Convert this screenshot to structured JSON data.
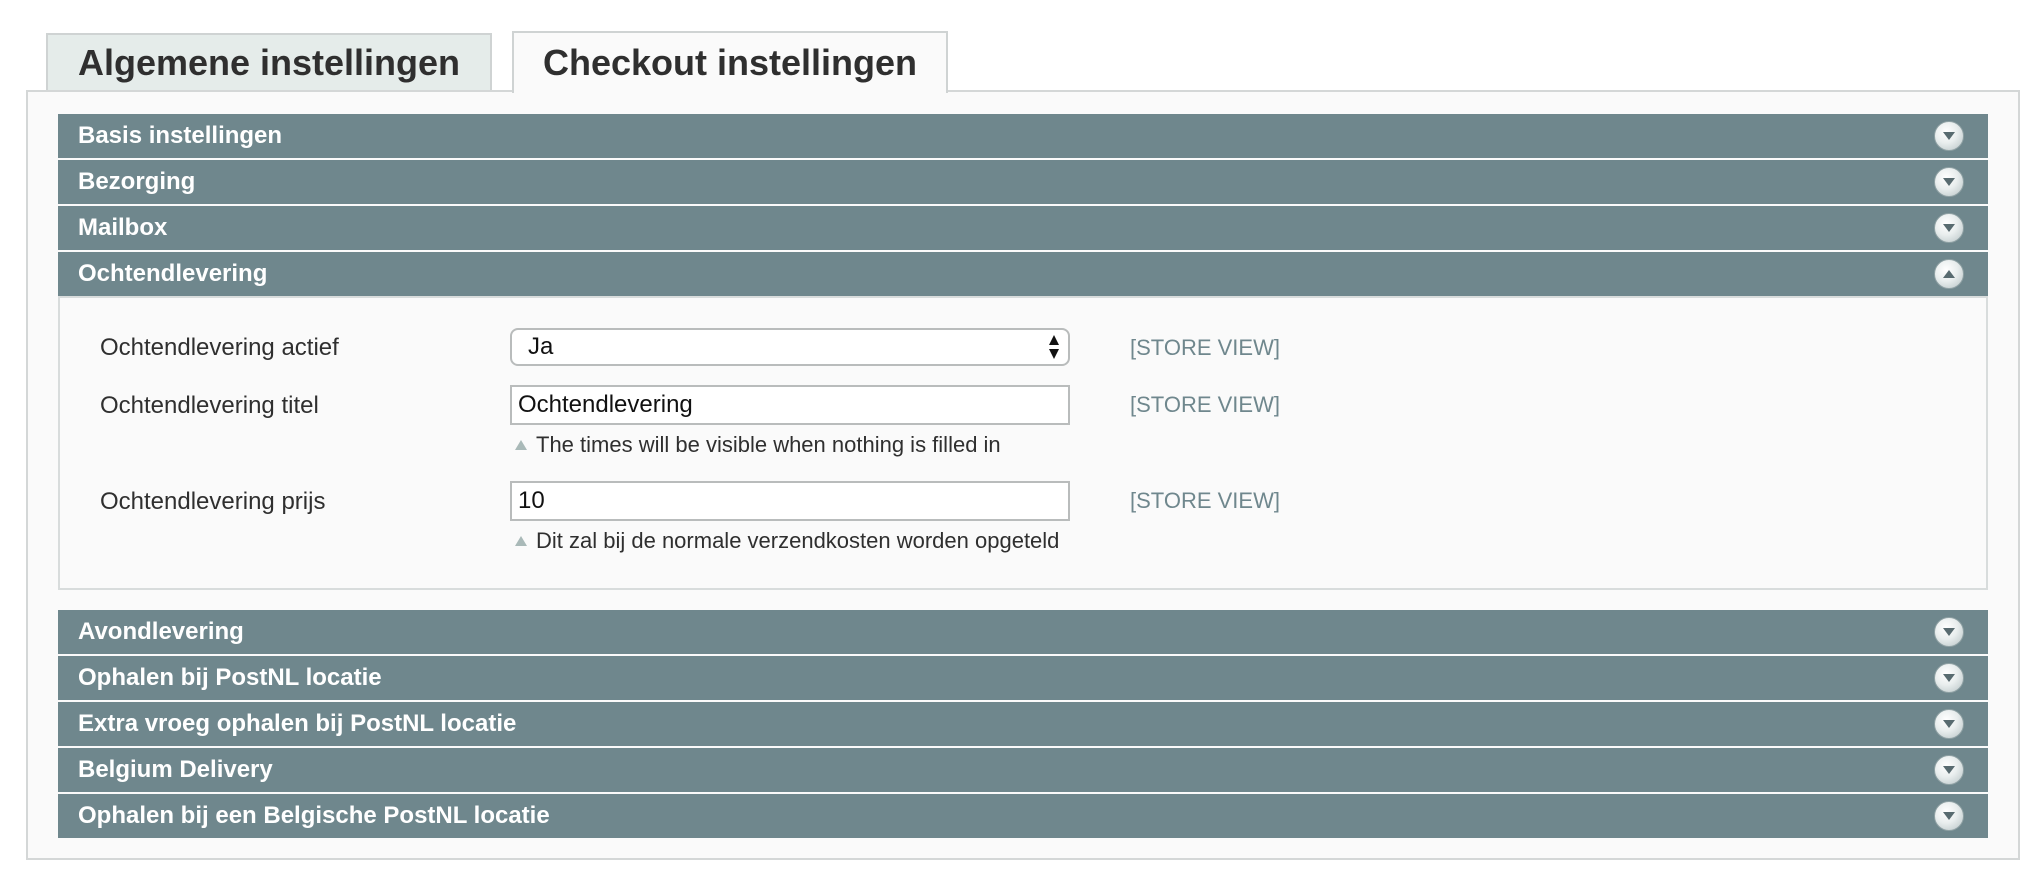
{
  "tabs": {
    "general": "Algemene instellingen",
    "checkout": "Checkout instellingen"
  },
  "sections_top": [
    {
      "title": "Basis instellingen",
      "state": "collapsed"
    },
    {
      "title": "Bezorging",
      "state": "collapsed"
    },
    {
      "title": "Mailbox",
      "state": "collapsed"
    },
    {
      "title": "Ochtendlevering",
      "state": "expanded"
    }
  ],
  "morning": {
    "active_label": "Ochtendlevering actief",
    "active_value": "Ja",
    "title_label": "Ochtendlevering titel",
    "title_value": "Ochtendlevering",
    "title_note": "The times will be visible when nothing is filled in",
    "price_label": "Ochtendlevering prijs",
    "price_value": "10",
    "price_note": "Dit zal bij de normale verzendkosten worden opgeteld",
    "scope": "[STORE VIEW]"
  },
  "sections_bottom": [
    {
      "title": "Avondlevering",
      "state": "collapsed"
    },
    {
      "title": "Ophalen bij PostNL locatie",
      "state": "collapsed"
    },
    {
      "title": "Extra vroeg ophalen bij PostNL locatie",
      "state": "collapsed"
    },
    {
      "title": "Belgium Delivery",
      "state": "collapsed"
    },
    {
      "title": "Ophalen bij een Belgische PostNL locatie",
      "state": "collapsed"
    }
  ],
  "colors": {
    "header_bg": "#6f878d",
    "scope_text": "#6f878d",
    "active_tab_bg": "#fafafa",
    "inactive_tab_bg": "#e5ecea"
  }
}
